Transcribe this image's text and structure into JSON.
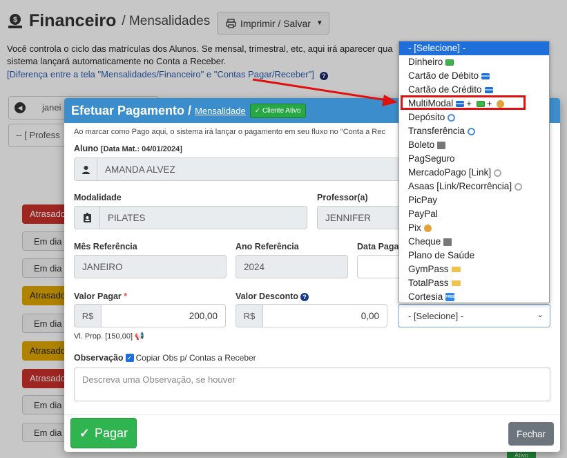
{
  "page": {
    "title": "Financeiro",
    "subtitle": "/ Mensalidades",
    "print_button": "Imprimir / Salvar",
    "description": "Você controla o ciclo das matrículas dos Alunos. Se mensal, trimestral, etc, aqui irá aparecer qua ... sistema lançará automaticamente no Conta a Receber.",
    "description_line1": "Você controla o ciclo das matrículas dos Alunos. Se mensal, trimestral, etc, aqui irá aparecer qua",
    "description_line2": "sistema lançará automaticamente no Conta a Receber.",
    "diff_link": "[Diferença entre a tela \"Mensalidades/Financeiro\" e \"Contas Pagar/Receber\"]",
    "pager_text": "janei",
    "professor_filter": "-- [ Profess",
    "statuses": [
      "Atrasado",
      "Em dia",
      "Em dia",
      "Atrasado",
      "Em dia",
      "Atrasado",
      "Atrasado",
      "Em dia",
      "Em dia"
    ],
    "bottom_row_badge": "Ativo"
  },
  "modal": {
    "title": "Efetuar Pagamento",
    "title_link": "Mensalidade",
    "badge": "Cliente Ativo",
    "notice": "Ao marcar como Pago aqui, o sistema irá lançar o pagamento em seu fluxo no \"Conta a Rec",
    "aluno_label": "Aluno",
    "aluno_date": "[Data Mat.: 04/01/2024]",
    "aluno_value": "AMANDA ALVEZ",
    "modalidade_label": "Modalidade",
    "modalidade_value": "PILATES",
    "professor_label": "Professor(a)",
    "professor_value": "JENNIFER",
    "mes_label": "Mês Referência",
    "mes_value": "JANEIRO",
    "ano_label": "Ano Referência",
    "ano_value": "2024",
    "data_label": "Data Paga",
    "valor_label": "Valor Pagar",
    "currency": "R$",
    "valor_value": "200,00",
    "desconto_label": "Valor Desconto",
    "desconto_value": "0,00",
    "vl_prop": "Vl. Prop. [150,00]",
    "obs_label": "Observação",
    "copy_obs": "Copiar Obs p/ Contas a Receber",
    "obs_placeholder": "Descreva uma Observação, se houver",
    "select_value": "- [Selecione] -",
    "pagar": "Pagar",
    "fechar": "Fechar"
  },
  "dropdown": {
    "options": [
      {
        "label": "- [Selecione] -",
        "icons": []
      },
      {
        "label": "Dinheiro",
        "icons": [
          "cash-icon"
        ]
      },
      {
        "label": "Cartão de Débito",
        "icons": [
          "card-icon"
        ]
      },
      {
        "label": "Cartão de Crédito",
        "icons": [
          "card-icon"
        ]
      },
      {
        "label": "MultiModal",
        "icons": [
          "card-icon",
          "+",
          "cash-icon",
          "+",
          "money-bag-icon"
        ]
      },
      {
        "label": "Depósito",
        "icons": [
          "cycle-icon"
        ]
      },
      {
        "label": "Transferência",
        "icons": [
          "cycle-icon"
        ]
      },
      {
        "label": "Boleto",
        "icons": [
          "bank-icon"
        ]
      },
      {
        "label": "PagSeguro",
        "icons": []
      },
      {
        "label": "MercadoPago [Link]",
        "icons": [
          "link-icon"
        ]
      },
      {
        "label": "Asaas [Link/Recorrência]",
        "icons": [
          "link-icon"
        ]
      },
      {
        "label": "PicPay",
        "icons": []
      },
      {
        "label": "PayPal",
        "icons": []
      },
      {
        "label": "Pix",
        "icons": [
          "money-bag-icon"
        ]
      },
      {
        "label": "Cheque",
        "icons": [
          "bank-icon"
        ]
      },
      {
        "label": "Plano de Saúde",
        "icons": []
      },
      {
        "label": "GymPass",
        "icons": [
          "ticket-icon"
        ]
      },
      {
        "label": "TotalPass",
        "icons": [
          "ticket-icon"
        ]
      },
      {
        "label": "Cortesia",
        "icons": [
          "free-icon"
        ]
      }
    ],
    "selected_index": 0,
    "highlighted_option": "MultiModal"
  },
  "colors": {
    "modal_header": "#3c8dcb",
    "pagar_button": "#2fb44f",
    "fechar_button": "#6c757d",
    "highlight": "#e01010",
    "selected_option": "#1e6fd9"
  }
}
